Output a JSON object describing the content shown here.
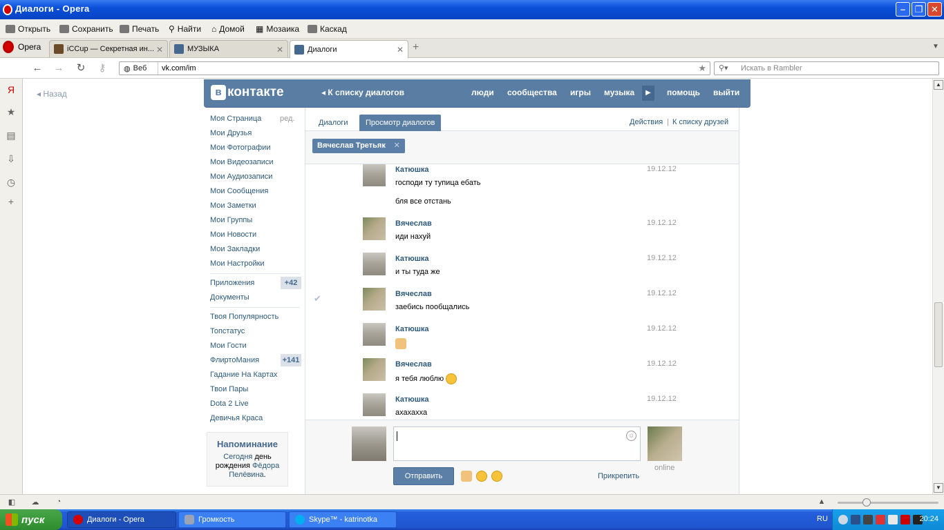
{
  "window": {
    "title": "Диалоги - Opera"
  },
  "menu": [
    "Открыть",
    "Сохранить",
    "Печать",
    "Найти",
    "Домой",
    "Мозаика",
    "Каскад"
  ],
  "tabs": {
    "opera_label": "Opera",
    "items": [
      {
        "label": "iCCup — Секретная ин..."
      },
      {
        "label": "МУЗЫКА"
      },
      {
        "label": "Диалоги"
      }
    ]
  },
  "address": {
    "web_label": "Веб",
    "url": "vk.com/im",
    "search_placeholder": "Искать в Rambler"
  },
  "page": {
    "back_label": "Назад",
    "vk": {
      "logo_text": "контакте",
      "logo_letter": "в",
      "to_list": "К списку диалогов",
      "nav": [
        "люди",
        "сообщества",
        "игры",
        "музыка",
        "помощь",
        "выйти"
      ]
    },
    "left_menu": {
      "edit_label": "ред.",
      "group1": [
        "Моя Страница",
        "Мои Друзья",
        "Мои Фотографии",
        "Мои Видеозаписи",
        "Мои Аудиозаписи",
        "Мои Сообщения",
        "Мои Заметки",
        "Мои Группы",
        "Мои Новости",
        "Мои Закладки",
        "Мои Настройки"
      ],
      "group2": [
        {
          "label": "Приложения",
          "badge": "+42"
        },
        {
          "label": "Документы",
          "badge": ""
        }
      ],
      "group3": [
        {
          "label": "Твоя Популярность",
          "badge": ""
        },
        {
          "label": "Топстатус",
          "badge": ""
        },
        {
          "label": "Мои Гости",
          "badge": ""
        },
        {
          "label": "ФлиртоМания",
          "badge": "+141"
        },
        {
          "label": "Гадание На Картах",
          "badge": ""
        },
        {
          "label": "Твои Пары",
          "badge": ""
        },
        {
          "label": "Dota 2 Live",
          "badge": ""
        },
        {
          "label": "Девичья Краса",
          "badge": ""
        }
      ]
    },
    "reminder": {
      "title": "Напоминание",
      "today": "Сегодня",
      "text1": "день рождения",
      "name": "Фёдора Пелёвина"
    },
    "dialog": {
      "tab_dialogs": "Диалоги",
      "tab_view": "Просмотр диалогов",
      "actions": "Действия",
      "separator": "|",
      "friends_list": "К списку друзей",
      "peer": "Вячеслав Третьяк",
      "messages": [
        {
          "author": "Катюшка",
          "date": "19.12.12",
          "text": "господи ту тупица ебать",
          "text2": "бля все отстань"
        },
        {
          "author": "Вячеслав",
          "date": "19.12.12",
          "text": "иди нахуй",
          "text2": ""
        },
        {
          "author": "Катюшка",
          "date": "19.12.12",
          "text": "и ты туда же",
          "text2": ""
        },
        {
          "author": "Вячеслав",
          "date": "19.12.12",
          "text": "заебись пообщались",
          "text2": ""
        },
        {
          "author": "Катюшка",
          "date": "19.12.12",
          "text": "",
          "text2": ""
        },
        {
          "author": "Вячеслав",
          "date": "19.12.12",
          "text": "я тебя люблю",
          "text2": ""
        },
        {
          "author": "Катюшка",
          "date": "19.12.12",
          "text": "ахахахха",
          "text2": ""
        }
      ],
      "send_label": "Отправить",
      "attach_label": "Прикрепить",
      "online_label": "online"
    }
  },
  "taskbar": {
    "start": "пуск",
    "items": [
      "Диалоги - Opera",
      "Громкость",
      "Skype™ - katrinotka"
    ],
    "lang": "RU",
    "clock": "20:24"
  },
  "colors": {
    "vk_blue": "#597da3",
    "vk_link": "#2b587a",
    "xp_blue": "#245edb"
  }
}
